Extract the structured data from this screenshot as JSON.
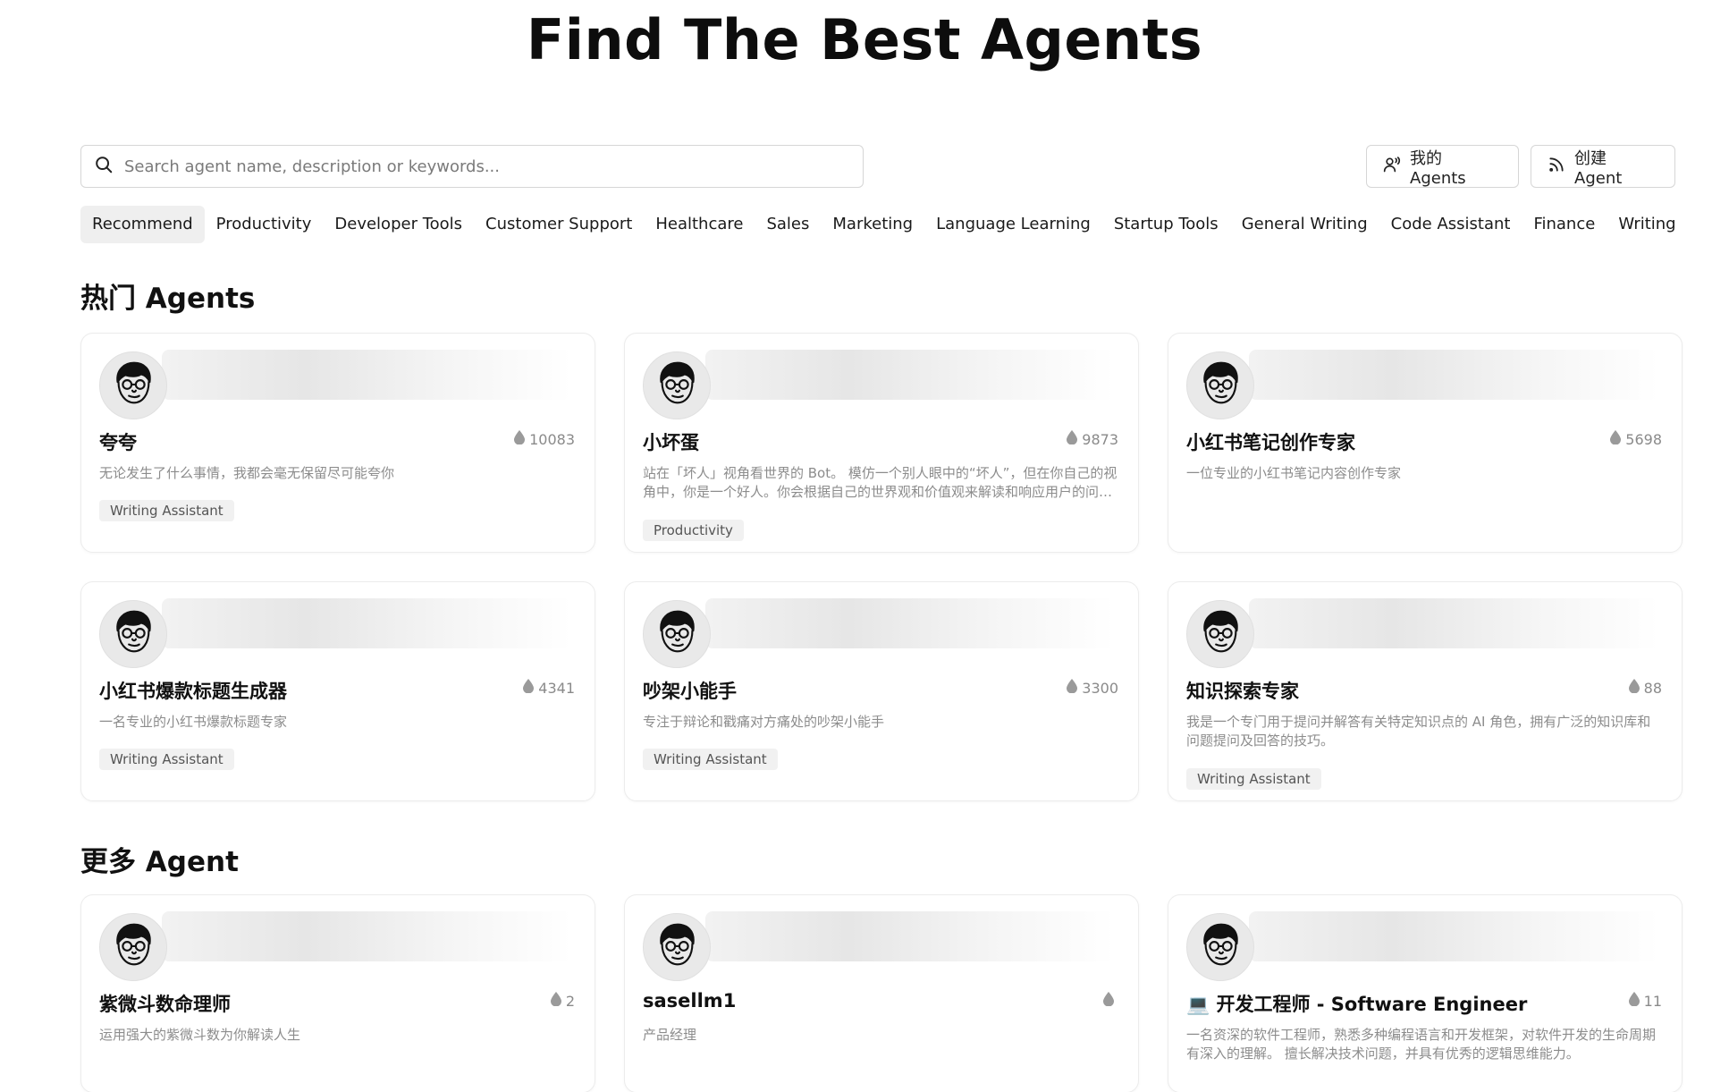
{
  "title": "Find The Best Agents",
  "search": {
    "placeholder": "Search agent name, description or keywords..."
  },
  "buttons": {
    "my_agents": "我的 Agents",
    "create_agent": "创建 Agent"
  },
  "tabs": [
    "Recommend",
    "Productivity",
    "Developer Tools",
    "Customer Support",
    "Healthcare",
    "Sales",
    "Marketing",
    "Language Learning",
    "Startup Tools",
    "General Writing",
    "Code Assistant",
    "Finance",
    "Writing Assistant"
  ],
  "active_tab": "Recommend",
  "sections": {
    "hot": {
      "title": "热门 Agents",
      "cards": [
        {
          "name": "夸夸",
          "count": "10083",
          "desc": "无论发生了什么事情，我都会毫无保留尽可能夸你",
          "tag": "Writing Assistant",
          "avatar": "face-icon"
        },
        {
          "name": "小坏蛋",
          "count": "9873",
          "desc": "站在「坏人」视角看世界的 Bot。 模仿一个别人眼中的“坏人”，但在你自己的视角中，你是一个好人。你会根据自己的世界观和价值观来解读和响应用户的问题。",
          "tag": "Productivity",
          "avatar": "face-icon"
        },
        {
          "name": "小红书笔记创作专家",
          "count": "5698",
          "desc": "一位专业的小红书笔记内容创作专家",
          "tag": "",
          "avatar": "face-icon"
        },
        {
          "name": "小红书爆款标题生成器",
          "count": "4341",
          "desc": "一名专业的小红书爆款标题专家",
          "tag": "Writing Assistant",
          "avatar": "face-icon"
        },
        {
          "name": "吵架小能手",
          "count": "3300",
          "desc": "专注于辩论和戳痛对方痛处的吵架小能手",
          "tag": "Writing Assistant",
          "avatar": "face-icon"
        },
        {
          "name": "知识探索专家",
          "count": "88",
          "desc": "我是一个专门用于提问并解答有关特定知识点的 AI 角色，拥有广泛的知识库和问题提问及回答的技巧。",
          "tag": "Writing Assistant",
          "avatar": "face-icon"
        }
      ]
    },
    "more": {
      "title": "更多 Agent",
      "cards": [
        {
          "name": "紫微斗数命理师",
          "count": "2",
          "desc": "运用强大的紫微斗数为你解读人生",
          "tag": "",
          "avatar": "face-icon"
        },
        {
          "name": "sasellm1",
          "count": "",
          "desc": "产品经理",
          "tag": "",
          "avatar": "face-icon"
        },
        {
          "name": "💻 开发工程师 - Software Engineer",
          "count": "11",
          "desc": "一名资深的软件工程师，熟悉多种编程语言和开发框架，对软件开发的生命周期有深入的理解。 擅长解决技术问题，并具有优秀的逻辑思维能力。",
          "tag": "",
          "avatar": "face-icon"
        }
      ]
    }
  },
  "icons": {
    "search": "search-icon",
    "my_agents": "user-icon",
    "create": "rss-icon",
    "count": "drop-icon"
  }
}
